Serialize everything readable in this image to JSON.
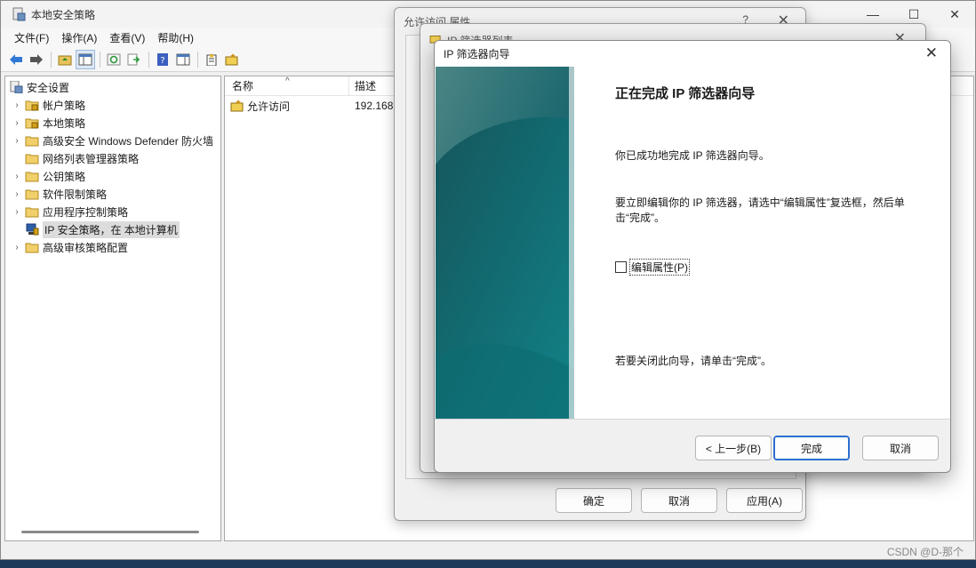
{
  "main_window": {
    "title": "本地安全策略",
    "menu": [
      "文件(F)",
      "操作(A)",
      "查看(V)",
      "帮助(H)"
    ],
    "controls": {
      "minimize": "—",
      "maximize": "☐",
      "close": "✕"
    }
  },
  "tree": {
    "root": "安全设置",
    "items": [
      {
        "label": "帐户策略",
        "expandable": true,
        "icon": "folder-lock-icon"
      },
      {
        "label": "本地策略",
        "expandable": true,
        "icon": "folder-lock-icon"
      },
      {
        "label": "高级安全 Windows Defender 防火墙",
        "expandable": true,
        "icon": "folder-icon"
      },
      {
        "label": "网络列表管理器策略",
        "expandable": false,
        "icon": "folder-icon"
      },
      {
        "label": "公钥策略",
        "expandable": true,
        "icon": "folder-icon"
      },
      {
        "label": "软件限制策略",
        "expandable": true,
        "icon": "folder-icon"
      },
      {
        "label": "应用程序控制策略",
        "expandable": true,
        "icon": "folder-icon"
      },
      {
        "label": "IP 安全策略，在 本地计算机",
        "expandable": false,
        "icon": "ip-security-icon",
        "selected": true
      },
      {
        "label": "高级审核策略配置",
        "expandable": true,
        "icon": "folder-icon"
      }
    ]
  },
  "list": {
    "headers": [
      "名称",
      "描述"
    ],
    "rows": [
      {
        "name": "允许访问",
        "desc": "192.168"
      }
    ]
  },
  "dialog_properties": {
    "title": "允许访问 属性",
    "help": "?",
    "close": "✕",
    "buttons": {
      "ok": "确定",
      "cancel": "取消",
      "apply": "应用(A)"
    }
  },
  "dialog_filter_list": {
    "title": "IP 筛选器列表",
    "close": "✕"
  },
  "wizard": {
    "title": "IP 筛选器向导",
    "close": "✕",
    "heading": "正在完成 IP 筛选器向导",
    "text_done": "你已成功地完成 IP 筛选器向导。",
    "text_edit": "要立即编辑你的 IP 筛选器，请选中“编辑属性”复选框，然后单击“完成”。",
    "checkbox_label": "编辑属性(P)",
    "checkbox_checked": false,
    "text_close": "若要关闭此向导，请单击“完成”。",
    "buttons": {
      "back": "< 上一步(B)",
      "finish": "完成",
      "cancel": "取消"
    }
  },
  "watermark": "CSDN @D-那个"
}
